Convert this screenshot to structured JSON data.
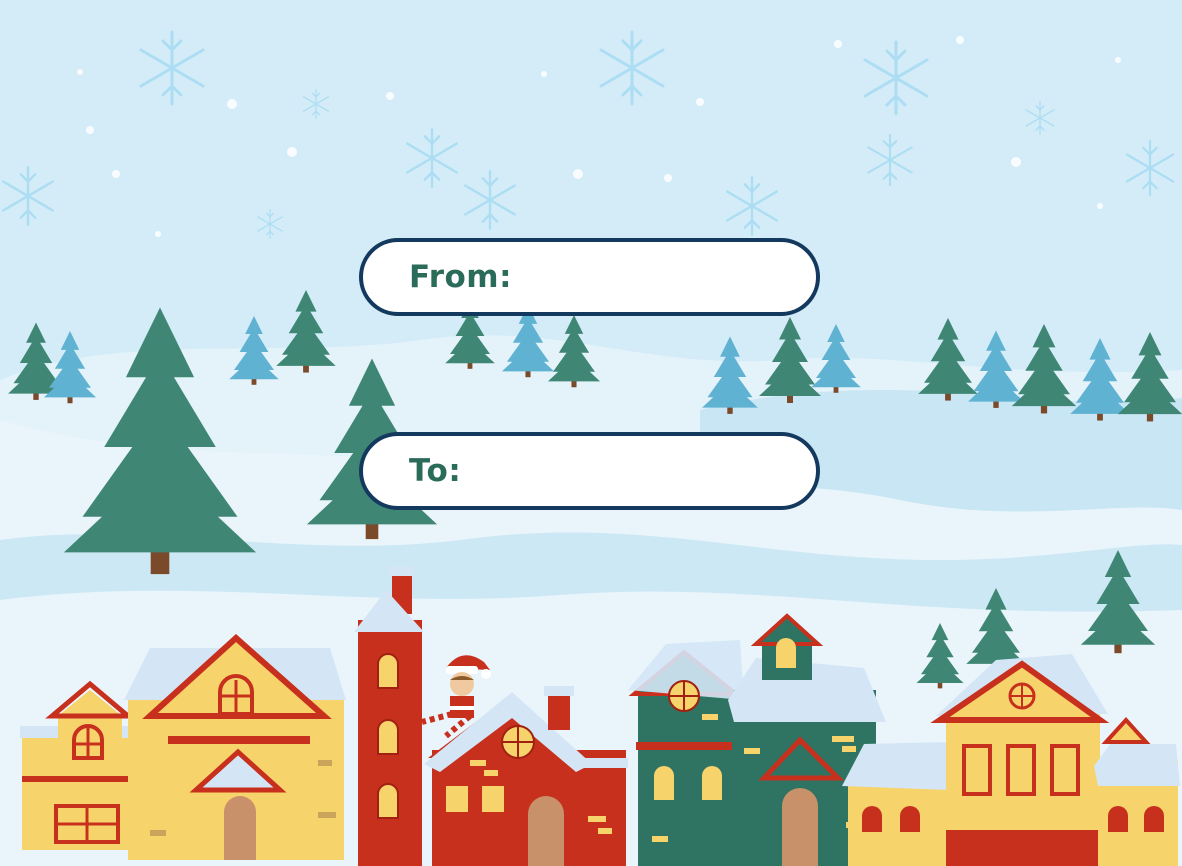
{
  "tag": {
    "from_label": "From:",
    "to_label": "To:"
  },
  "colors": {
    "sky": "#d3ecf8",
    "snow": "#eaf5fb",
    "pine_dark": "#3f8774",
    "pine_light": "#5fb2d2",
    "field_border": "#14395e",
    "label_text": "#2a6b5a",
    "house_yellow": "#f6d36b",
    "house_red": "#c8301e",
    "house_green": "#2f7462"
  },
  "icons": [
    "snowflake-icon",
    "pine-tree-icon",
    "house-icon",
    "elf-icon"
  ]
}
